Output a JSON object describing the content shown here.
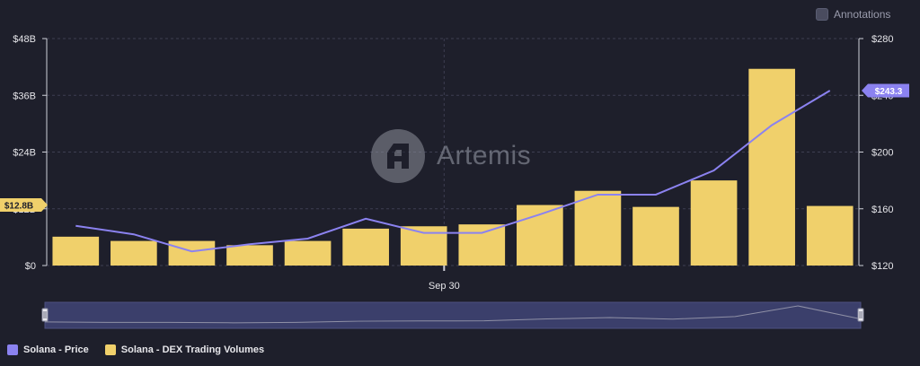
{
  "annotations": {
    "label": "Annotations"
  },
  "watermark": {
    "text": "Artemis"
  },
  "legend": [
    {
      "label": "Solana - Price",
      "color": "#8b82f0"
    },
    {
      "label": "Solana - DEX Trading Volumes",
      "color": "#f0d06b"
    }
  ],
  "chart_data": {
    "type": "bar",
    "categories": [
      "",
      "",
      "",
      "",
      "",
      "",
      "",
      "",
      "",
      "",
      "",
      "",
      "",
      ""
    ],
    "x_tick_labels": [
      {
        "index": 6.35,
        "label": "Sep 30"
      }
    ],
    "series": [
      {
        "name": "Solana - DEX Trading Volumes",
        "type": "bar",
        "axis": "left",
        "color": "#f0d06b",
        "values": [
          6.1,
          5.2,
          5.2,
          4.3,
          5.2,
          7.8,
          8.3,
          8.7,
          12.8,
          15.8,
          12.4,
          18.0,
          41.6,
          12.6
        ]
      },
      {
        "name": "Solana - Price",
        "type": "line",
        "axis": "right",
        "color": "#8b82f0",
        "values": [
          148,
          142,
          130,
          135,
          139,
          153,
          143,
          143,
          156,
          170,
          170,
          187,
          219,
          243.3
        ]
      }
    ],
    "y_left": {
      "min": 0,
      "max": 48,
      "ticks": [
        "$0",
        "$12B",
        "$24B",
        "$36B",
        "$48B"
      ]
    },
    "y_right": {
      "min": 120,
      "max": 280,
      "ticks": [
        "$120",
        "$160",
        "$200",
        "$240",
        "$280"
      ]
    },
    "callout_left": {
      "value": 12.8,
      "label": "$12.8B",
      "color": "#f0d06b"
    },
    "callout_right": {
      "value": 243.3,
      "label": "$243.3",
      "color": "#8b82f0"
    },
    "grid": true,
    "navigator_values": [
      6.1,
      5.2,
      5.2,
      4.3,
      5.2,
      7.8,
      8.3,
      8.7,
      12.8,
      15.8,
      12.4,
      18.0,
      41.6,
      12.6
    ]
  }
}
